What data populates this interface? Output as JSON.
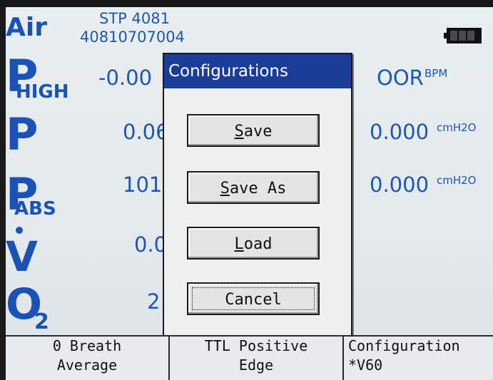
{
  "status": {
    "gas": "Air",
    "device_model": "STP 4081",
    "serial_number": "40810707004",
    "battery_icon": "battery-icon"
  },
  "readings": [
    {
      "symbol": "P",
      "subscript": "HIGH",
      "value": "-0.00",
      "right_value": "OOR",
      "right_unit": "BPM"
    },
    {
      "symbol": "P",
      "subscript": "",
      "value": "0.06",
      "right_value": "0.000",
      "right_unit": "cmH2O"
    },
    {
      "symbol": "P",
      "subscript": "ABS",
      "value": "101",
      "right_value": "0.000",
      "right_unit": "cmH2O"
    },
    {
      "symbol": "V",
      "subscript": "",
      "value": "0.0",
      "right_value": "",
      "right_unit": ""
    },
    {
      "symbol": "O",
      "subscript": "2",
      "value": "2",
      "right_value": "",
      "right_unit": ""
    }
  ],
  "dialog": {
    "title": "Configurations",
    "buttons": [
      {
        "underline": "S",
        "rest": "ave"
      },
      {
        "underline": "S",
        "rest": "ave As"
      },
      {
        "underline": "L",
        "rest": "oad"
      },
      {
        "underline": "",
        "rest": "Cancel"
      }
    ]
  },
  "softkeys": [
    {
      "line1": "0 Breath",
      "line2": "Average"
    },
    {
      "line1": "TTL Positive",
      "line2": "Edge"
    },
    {
      "line1": "Configuration",
      "line2": "*V60"
    }
  ],
  "colors": {
    "reading_blue": "#1f56b5",
    "title_bar": "#1a3e98",
    "screen_bg": "#e6ebee"
  }
}
